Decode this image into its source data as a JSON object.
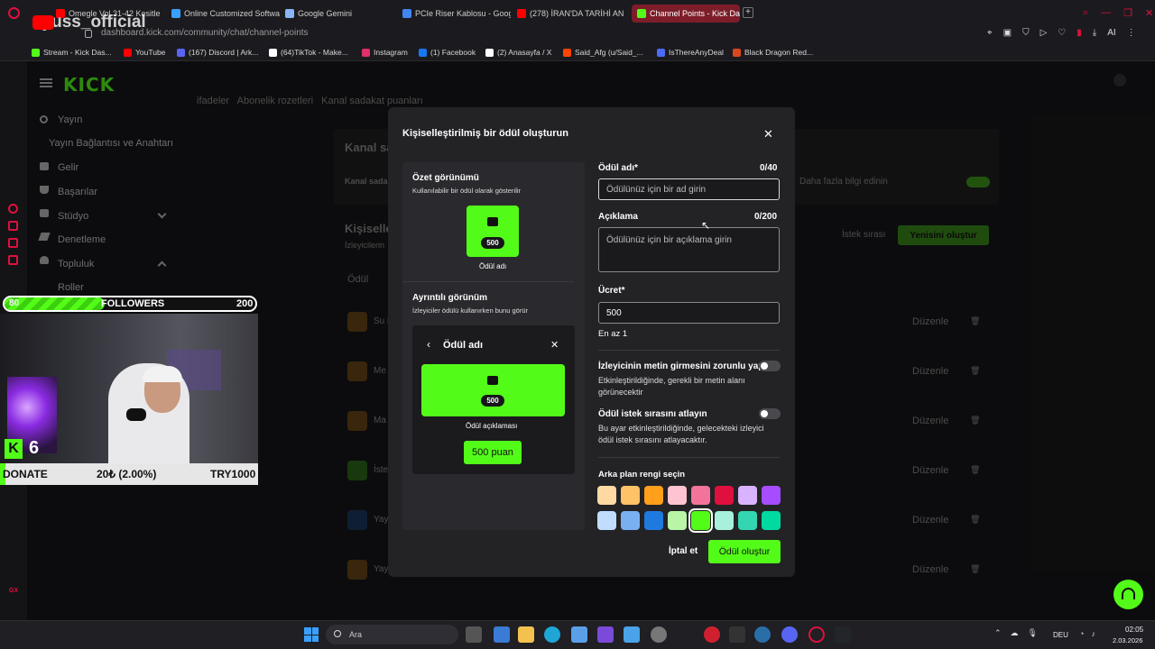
{
  "tabs": [
    {
      "label": "Omegle Vol 31-42 Kesitle",
      "color": "#ff0000"
    },
    {
      "label": "Online Customized Softwa",
      "color": "#3aa0ff"
    },
    {
      "label": "Google Gemini",
      "color": "#8ab4f8"
    },
    {
      "label": "PCIe Riser Kablosu - Goog",
      "color": "#4285f4"
    },
    {
      "label": "(278) İRAN'DA TARİHİ AN",
      "color": "#ff0000"
    },
    {
      "label": "Channel Points - Kick Das",
      "color": "#53fc18"
    }
  ],
  "url": "dashboard.kick.com/community/chat/channel-points",
  "watermark": "ayuss_official",
  "bookmarks": [
    {
      "label": "Stream - Kick Das...",
      "color": "#53fc18"
    },
    {
      "label": "YouTube",
      "color": "#ff0000"
    },
    {
      "label": "(167) Discord | Ark...",
      "color": "#5865f2"
    },
    {
      "label": "(64)TikTok - Make...",
      "color": "#ffffff"
    },
    {
      "label": "Instagram",
      "color": "#e1306c"
    },
    {
      "label": "(1) Facebook",
      "color": "#1877f2"
    },
    {
      "label": "(2) Anasayfa / X",
      "color": "#ffffff"
    },
    {
      "label": "Said_Afg (u/Said_...",
      "color": "#ff4500"
    },
    {
      "label": "IsThereAnyDeal",
      "color": "#4a6cf7"
    },
    {
      "label": "Black Dragon Red...",
      "color": "#d9471c"
    }
  ],
  "kick_logo": "KICK",
  "sidebar": {
    "items": [
      "Yayın",
      "Yayın Bağlantısı ve Anahtarı",
      "Gelir",
      "Başarılar",
      "Stüdyo",
      "Denetleme",
      "Topluluk",
      "Roller"
    ]
  },
  "main": {
    "tabs_row": "ifadeler   Abonelik rozetleri   Kanal sadakat puanları",
    "section_title": "Kanal sa",
    "section_row": "Kanal sada",
    "learn_more": "Daha fazla bilgi edinin",
    "rewards_title": "Kişiselle",
    "rewards_sub": "İzleyicilerin",
    "queue_btn": "İstek sırası",
    "new_btn": "Yenisini oluştur",
    "col_reward": "Ödül",
    "rows": [
      "Su i",
      "Me",
      "Ma",
      "İste",
      "Yay",
      "Yay"
    ],
    "edit_label": "Düzenle"
  },
  "modal": {
    "title": "Kişiselleştirilmiş bir ödül oluşturun",
    "summary_title": "Özet görünümü",
    "summary_sub": "Kullanılabilir bir ödül olarak gösterilir",
    "tile_cost": "500",
    "tile_label": "Ödül adı",
    "detail_title": "Ayrıntılı görünüm",
    "detail_sub": "İzleyiciler ödülü kullanırken bunu görür",
    "detail_header": "Ödül adı",
    "detail_cost": "500",
    "detail_desc": "Ödül açıklaması",
    "detail_btn": "500 puan",
    "name_label": "Ödül adı*",
    "name_count": "0/40",
    "name_placeholder": "Ödülünüz için bir ad girin",
    "desc_label": "Açıklama",
    "desc_count": "0/200",
    "desc_placeholder": "Ödülünüz için bir açıklama girin",
    "cost_label": "Ücret*",
    "cost_value": "500",
    "cost_hint": "En az 1",
    "req_text_label": "İzleyicinin metin girmesini zorunlu yap",
    "req_text_desc": "Etkinleştirildiğinde, gerekli bir metin alanı görünecektir",
    "skip_label": "Ödül istek sırasını atlayın",
    "skip_desc": "Bu ayar etkinleştirildiğinde, gelecekteki izleyici ödül istek sırasını atlayacaktır.",
    "color_label": "Arka plan rengi seçin",
    "colors": [
      "#ffd9a3",
      "#ffc266",
      "#ff9f1a",
      "#ffc4cf",
      "#f2749a",
      "#e0103e",
      "#d9b3ff",
      "#a64dff",
      "#c2dcff",
      "#7ab0f2",
      "#1f7ae0",
      "#b8f5a6",
      "#53fc18",
      "#a6f0dc",
      "#33d6b0",
      "#00d9a0"
    ],
    "cancel": "İptal et",
    "submit": "Ödül oluştur"
  },
  "stream_overlay": {
    "follow_current": "80",
    "follow_label": "FOLLOWERS",
    "follow_goal": "200",
    "donate_label": "DONATE",
    "donate_value": "20₺ (2.00%)",
    "donate_goal": "TRY1000",
    "badge": "6"
  },
  "taskbar": {
    "search": "Ara",
    "lang": "DEU",
    "time": "02:05",
    "date": "2.03.2026"
  }
}
